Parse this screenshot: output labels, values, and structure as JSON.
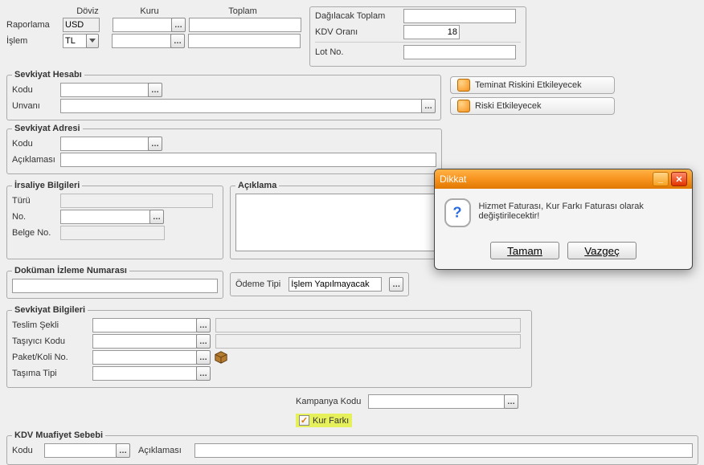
{
  "top": {
    "col_doviz": "Döviz",
    "col_kuru": "Kuru",
    "col_toplam": "Toplam",
    "raporlama_label": "Raporlama",
    "raporlama_value": "USD",
    "islem_label": "İşlem",
    "islem_value": "TL",
    "dagilacak_toplam_label": "Dağılacak Toplam",
    "kdv_orani_label": "KDV Oranı",
    "kdv_orani_value": "18",
    "lot_no_label": "Lot No."
  },
  "sideButtons": {
    "teminat": "Teminat Riskini Etkileyecek",
    "riski": "Riski Etkileyecek"
  },
  "sevkiyatHesabi": {
    "legend": "Sevkiyat Hesabı",
    "kodu_label": "Kodu",
    "unvani_label": "Unvanı"
  },
  "sevkiyatAdresi": {
    "legend": "Sevkiyat Adresi",
    "kodu_label": "Kodu",
    "aciklamasi_label": "Açıklaması"
  },
  "irsaliye": {
    "legend": "İrsaliye Bilgileri",
    "turu_label": "Türü",
    "no_label": "No.",
    "belge_no_label": "Belge No."
  },
  "aciklama": {
    "legend": "Açıklama"
  },
  "dokuman": {
    "legend": "Doküman İzleme Numarası"
  },
  "odeme": {
    "label": "Ödeme Tipi",
    "value": "İşlem Yapılmayacak"
  },
  "sevkiyatBilgileri": {
    "legend": "Sevkiyat Bilgileri",
    "teslim_sekli": "Teslim Şekli",
    "tasiyici_kodu": "Taşıyıcı Kodu",
    "paket_koli_no": "Paket/Koli No.",
    "tasima_tipi": "Taşıma Tipi"
  },
  "kampanya": {
    "label": "Kampanya Kodu",
    "kur_farki": "Kur Farkı"
  },
  "kdvMuafiyet": {
    "legend": "KDV Muafiyet Sebebi",
    "kodu_label": "Kodu",
    "aciklamasi_label": "Açıklaması"
  },
  "dialog": {
    "title": "Dikkat",
    "message": "Hizmet Faturası, Kur Farkı Faturası olarak değiştirilecektir!",
    "ok": "Tamam",
    "cancel": "Vazgeç"
  }
}
